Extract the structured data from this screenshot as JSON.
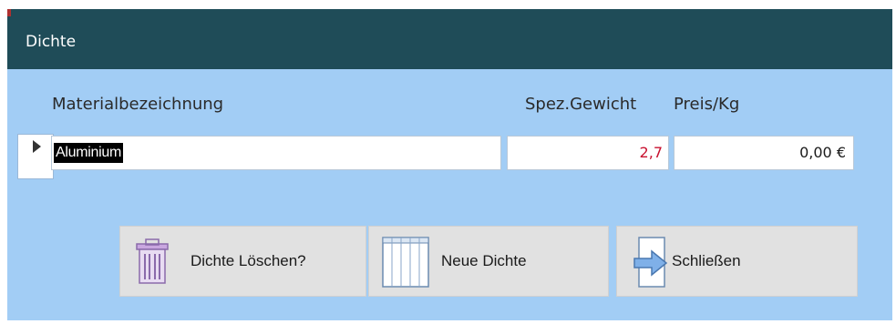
{
  "window": {
    "title": "Dichte"
  },
  "columns": {
    "material": "Materialbezeichnung",
    "weight": "Spez.Gewicht",
    "price": "Preis/Kg"
  },
  "record": {
    "material": "Aluminium",
    "weight": "2,7",
    "price": "0,00 €"
  },
  "buttons": {
    "delete": "Dichte Löschen?",
    "new": "Neue Dichte",
    "close": "Schließen"
  },
  "icons": {
    "delete": "trash-can-icon",
    "new": "grid-sheet-icon",
    "close": "exit-arrow-icon"
  },
  "colors": {
    "titlebar": "#1f4c58",
    "background": "#a2cdf5",
    "weight_text": "#c8102e"
  }
}
